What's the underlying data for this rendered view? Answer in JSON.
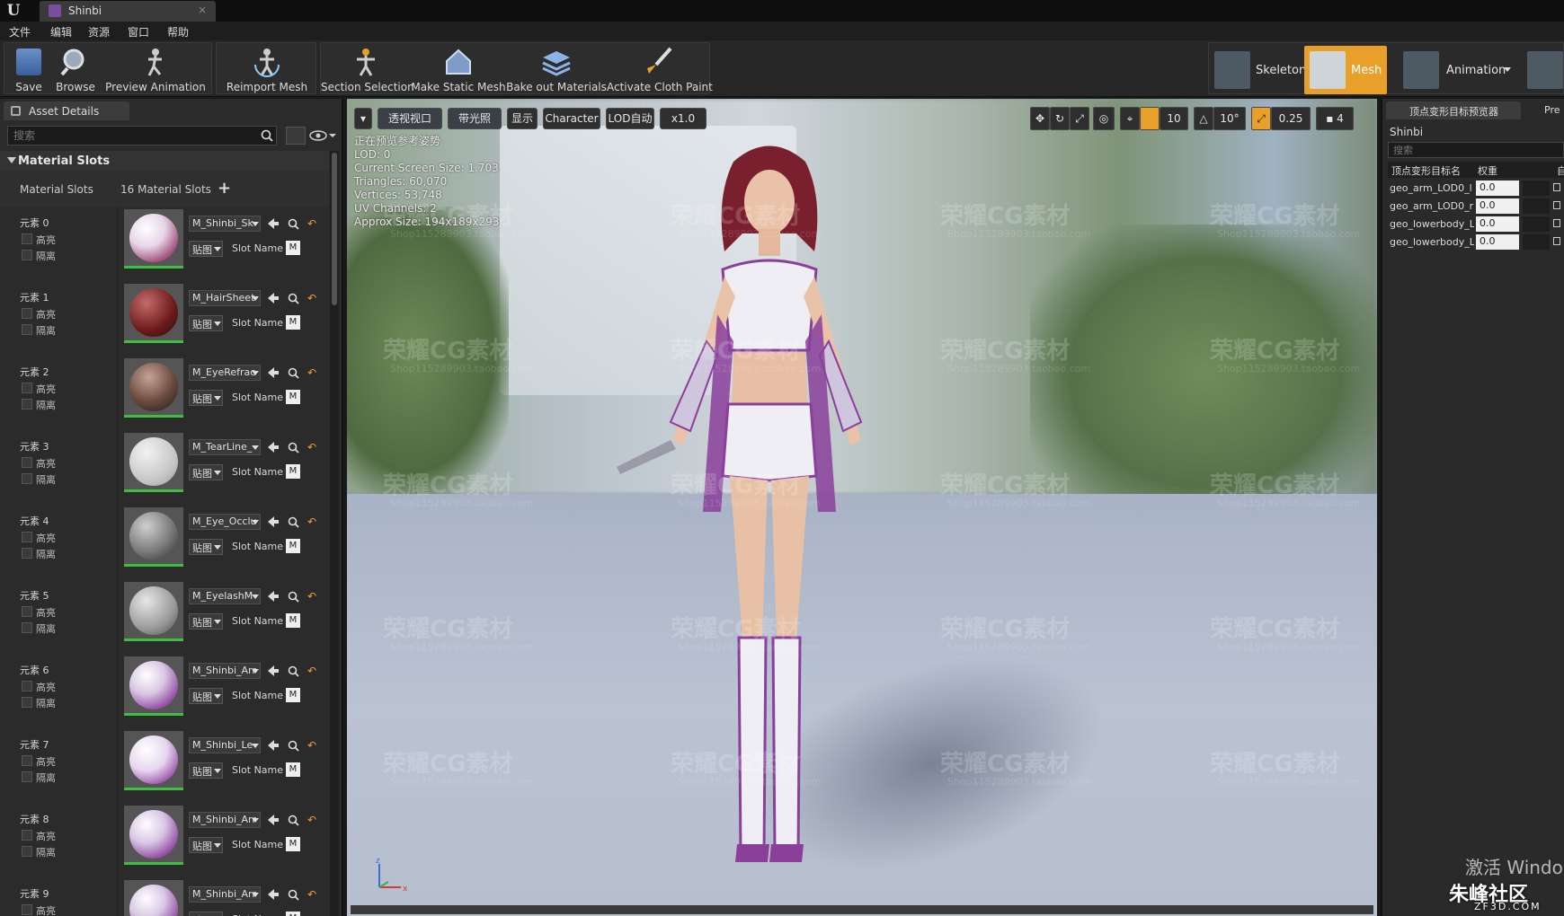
{
  "window": {
    "tab_title": "Shinbi"
  },
  "menu": [
    "文件",
    "编辑",
    "资源",
    "窗口",
    "帮助"
  ],
  "toolbar": {
    "buttons": [
      "Save",
      "Browse",
      "Preview Animation",
      "Reimport Mesh",
      "Section Selection",
      "Make Static Mesh",
      "Bake out Materials",
      "Activate Cloth Paint"
    ],
    "modes": [
      "Skeleton",
      "Mesh",
      "Animation"
    ]
  },
  "asset_details": {
    "tab": "Asset Details",
    "search_placeholder": "搜索",
    "section_title": "Material Slots",
    "slots_label": "Material Slots",
    "slots_count": "16 Material Slots",
    "highlight_label": "高亮",
    "isolate_label": "隔离",
    "texture_label": "贴图",
    "slot_name_label": "Slot Name",
    "slot_name_value": "M",
    "slots": [
      {
        "label": "元素 0",
        "material": "M_Shinbi_Sk"
      },
      {
        "label": "元素 1",
        "material": "M_HairSheet"
      },
      {
        "label": "元素 2",
        "material": "M_EyeRefrac"
      },
      {
        "label": "元素 3",
        "material": "M_TearLine_"
      },
      {
        "label": "元素 4",
        "material": "M_Eye_Occlu"
      },
      {
        "label": "元素 5",
        "material": "M_EyelashM"
      },
      {
        "label": "元素 6",
        "material": "M_Shinbi_Arr"
      },
      {
        "label": "元素 7",
        "material": "M_Shinbi_Le"
      },
      {
        "label": "元素 8",
        "material": "M_Shinbi_Arr"
      },
      {
        "label": "元素 9",
        "material": "M_Shinbi_Arr"
      }
    ]
  },
  "viewport": {
    "buttons": [
      "透视视口",
      "带光照",
      "显示",
      "Character",
      "LOD自动",
      "x1.0"
    ],
    "stats": [
      "正在预览参考姿势",
      "LOD: 0",
      "Current Screen Size: 1.703",
      "Triangles: 60,070",
      "Vertices: 53,748",
      "UV Channels: 2",
      "Approx Size: 194x189x293"
    ],
    "grid_snap": "10",
    "rotation_snap": "10°",
    "scale_snap": "0.25",
    "camera_speed": "4"
  },
  "morph_targets": {
    "tab": "顶点变形目标预览器",
    "tab2": "Pre",
    "asset_name": "Shinbi",
    "search_placeholder": "搜索",
    "col_name": "顶点变形目标名",
    "col_weight": "权重",
    "col_auto": "自",
    "rows": [
      {
        "name": "geo_arm_LOD0_l",
        "weight": "0.0"
      },
      {
        "name": "geo_arm_LOD0_r",
        "weight": "0.0"
      },
      {
        "name": "geo_lowerbody_L",
        "weight": "0.0"
      },
      {
        "name": "geo_lowerbody_L",
        "weight": "0.0"
      }
    ]
  },
  "overlay": {
    "watermark": "荣耀CG素材",
    "watermark_sub": "Shop115289903.taobao.com",
    "activate_windows": "激活 Windo",
    "site_logo": "朱峰社区",
    "site_sub": "ZF3D.COM"
  },
  "colors": {
    "accent_orange": "#e8a02a",
    "thumb_green": "#3fbf3f",
    "costume_purple": "#8a3f9a"
  }
}
